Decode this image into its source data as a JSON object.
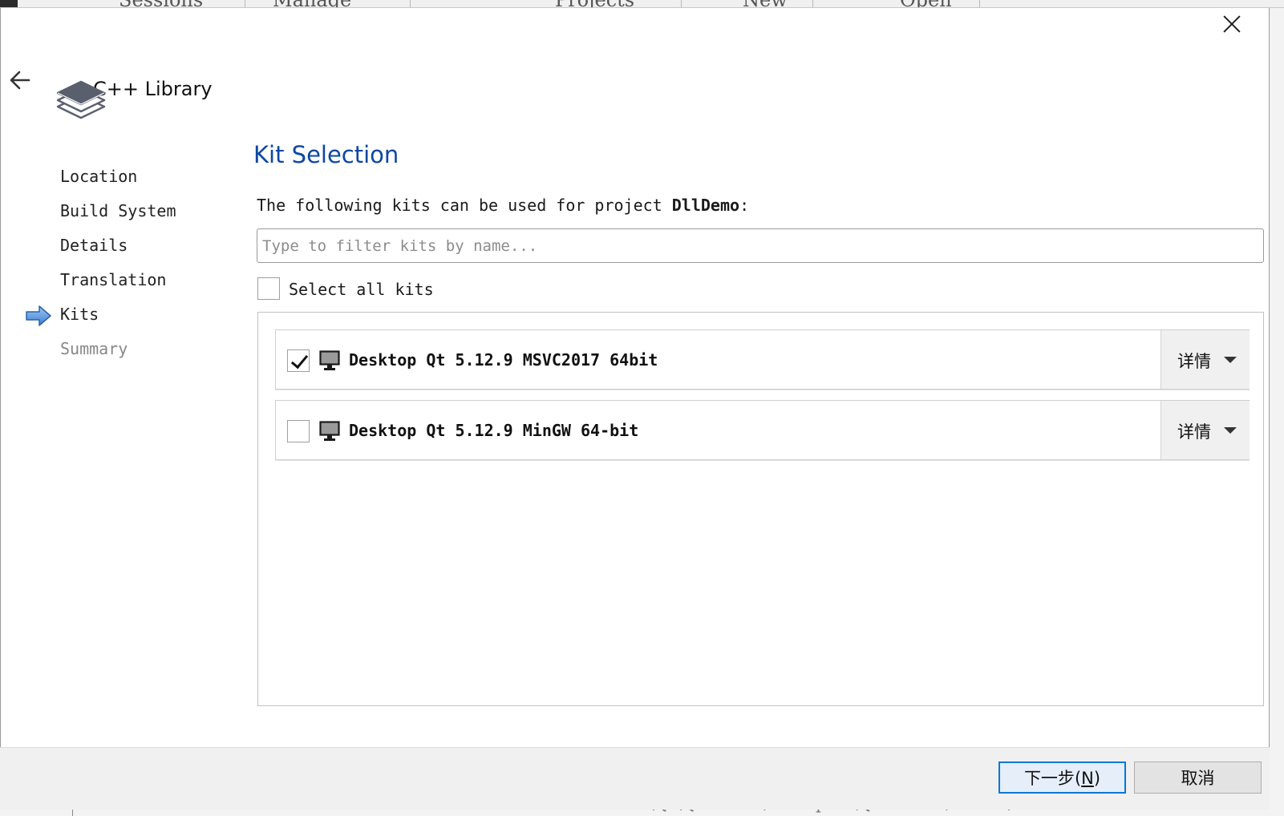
{
  "background": {
    "tabs": [
      "Sessions",
      "Manage",
      "Projects",
      "New",
      "Open"
    ],
    "status_text": "E:\\Qt\\Qt5.12.9\\Examples\\Qt-5.12.9\\charts\\..."
  },
  "header": {
    "wizard_title": "C++ Library",
    "icon": "library-stack-icon"
  },
  "steps": [
    {
      "label": "Location",
      "state": "done"
    },
    {
      "label": "Build System",
      "state": "done"
    },
    {
      "label": "Details",
      "state": "done"
    },
    {
      "label": "Translation",
      "state": "done"
    },
    {
      "label": "Kits",
      "state": "current"
    },
    {
      "label": "Summary",
      "state": "pending"
    }
  ],
  "page": {
    "title": "Kit Selection",
    "intro_prefix": "The following kits can be used for project ",
    "project_name": "DllDemo",
    "intro_suffix": ":",
    "filter_placeholder": "Type to filter kits by name...",
    "filter_value": "",
    "select_all_label": "Select all kits",
    "select_all_checked": false
  },
  "kits": [
    {
      "name": "Desktop Qt 5.12.9 MSVC2017 64bit",
      "checked": true,
      "details_label": "详情",
      "icon": "monitor-icon"
    },
    {
      "name": "Desktop Qt 5.12.9 MinGW 64-bit",
      "checked": false,
      "details_label": "详情",
      "icon": "monitor-icon"
    }
  ],
  "footer": {
    "next_label": "下一步",
    "next_mnemonic": "N",
    "cancel_label": "取消"
  },
  "colors": {
    "title_blue": "#0d47a1",
    "focus_blue": "#0078d7",
    "step_arrow_blue": "#4a90e2"
  }
}
